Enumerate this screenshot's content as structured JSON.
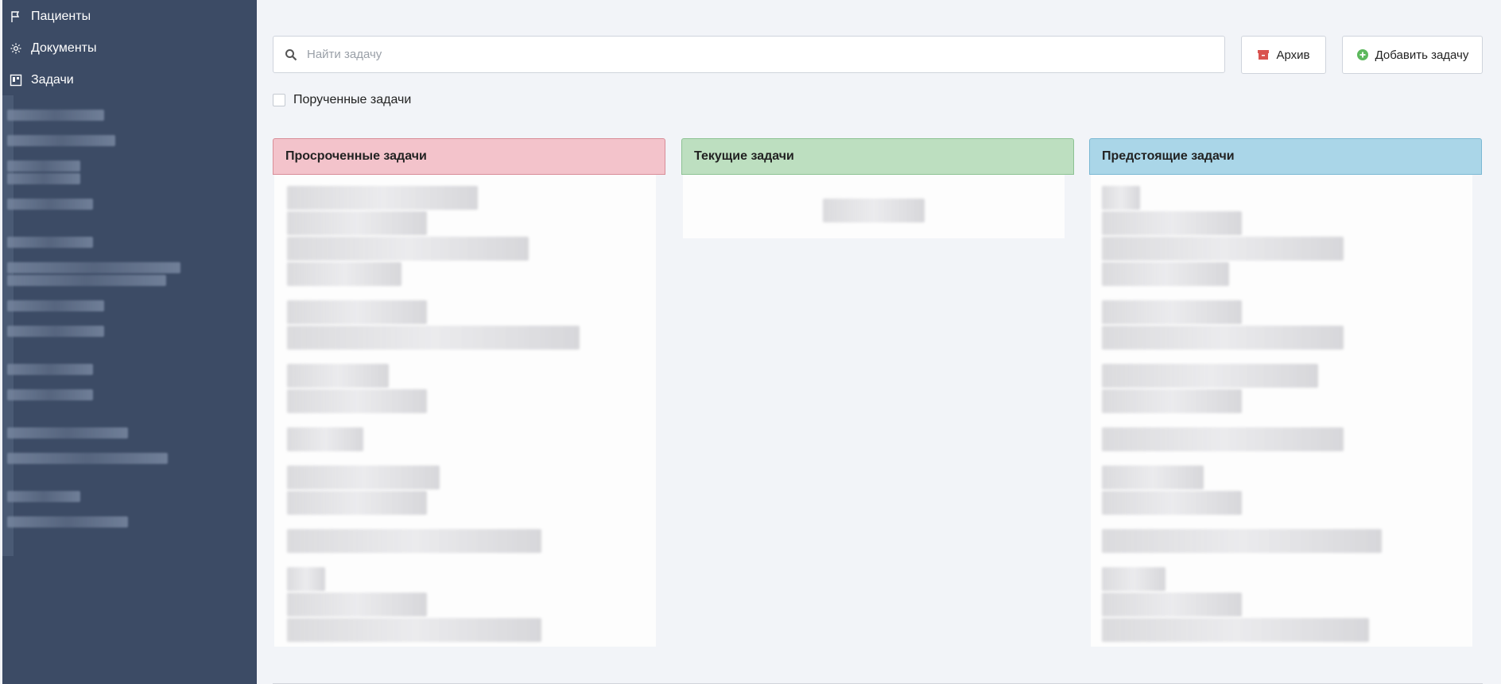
{
  "sidebar": {
    "items": [
      {
        "label": "Пациенты",
        "icon": "flag-icon"
      },
      {
        "label": "Документы",
        "icon": "gear-icon"
      },
      {
        "label": "Задачи",
        "icon": "board-icon"
      }
    ]
  },
  "search": {
    "placeholder": "Найти задачу"
  },
  "toolbar": {
    "archive_label": "Архив",
    "add_label": "Добавить задачу"
  },
  "filters": {
    "assigned_label": "Порученные задачи",
    "assigned_checked": false
  },
  "columns": {
    "overdue": {
      "title": "Просроченные задачи",
      "color": "#f3c3cb"
    },
    "current": {
      "title": "Текущие задачи",
      "color": "#bddfc0"
    },
    "upcoming": {
      "title": "Предстоящие задачи",
      "color": "#aad6e8"
    }
  },
  "colors": {
    "sidebar": "#3c4b65",
    "archive_icon": "#d9534f",
    "add_icon": "#5cb85c"
  }
}
